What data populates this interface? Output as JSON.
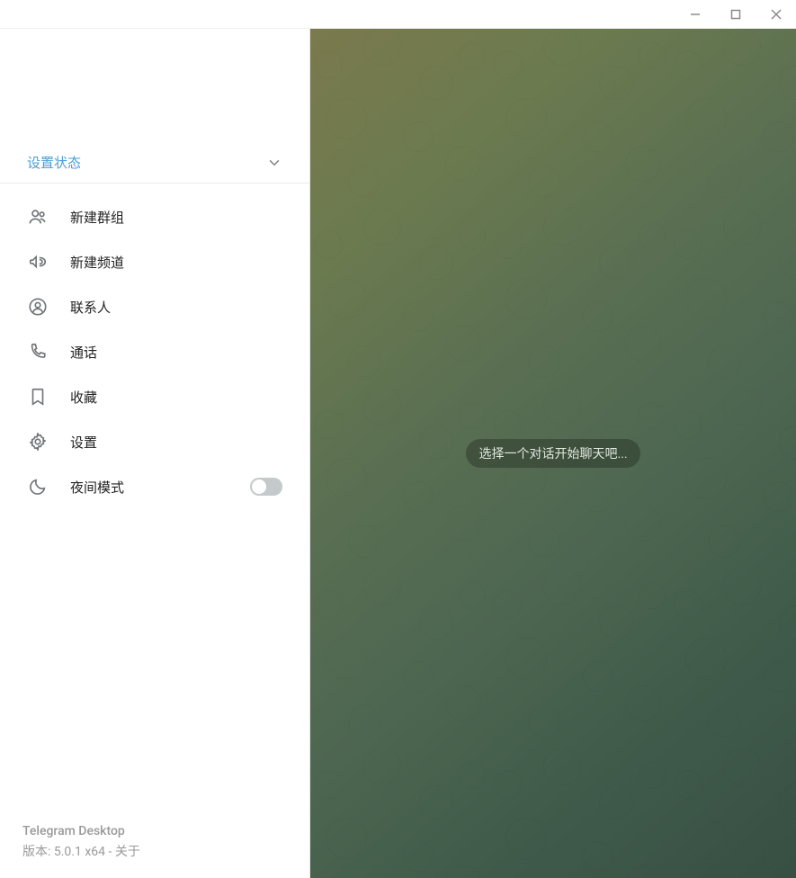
{
  "titlebar": {
    "minimize_tip": "minimize",
    "maximize_tip": "maximize",
    "close_tip": "close"
  },
  "status": {
    "set_status_label": "设置状态"
  },
  "menu": {
    "items": [
      {
        "id": "new-group",
        "label": "新建群组"
      },
      {
        "id": "new-channel",
        "label": "新建频道"
      },
      {
        "id": "contacts",
        "label": "联系人"
      },
      {
        "id": "calls",
        "label": "通话"
      },
      {
        "id": "saved",
        "label": "收藏"
      },
      {
        "id": "settings",
        "label": "设置"
      },
      {
        "id": "night-mode",
        "label": "夜间模式"
      }
    ]
  },
  "night_mode": {
    "enabled": false
  },
  "footer": {
    "app_name": "Telegram Desktop",
    "version_prefix": "版本: ",
    "version": "5.0.1 x64",
    "separator": " - ",
    "about_label": "关于"
  },
  "content": {
    "empty_hint": "选择一个对话开始聊天吧..."
  }
}
